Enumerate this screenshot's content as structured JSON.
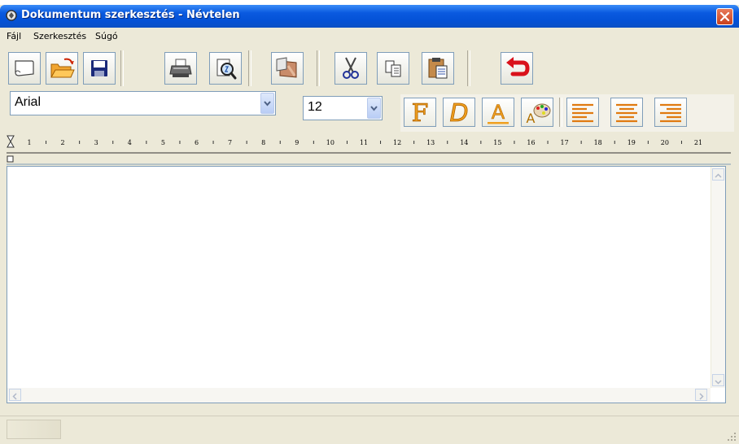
{
  "window": {
    "title": "Dokumentum szerkesztés - Névtelen"
  },
  "menubar": {
    "items": [
      {
        "label": "Fájl"
      },
      {
        "label": "Szerkesztés"
      },
      {
        "label": "Súgó"
      }
    ]
  },
  "toolbar": {
    "icons": [
      "new-document-icon",
      "open-folder-icon",
      "save-disk-icon",
      "print-icon",
      "print-preview-icon",
      "image-icon",
      "cut-scissors-icon",
      "copy-icon",
      "paste-icon",
      "undo-arrow-icon"
    ]
  },
  "format": {
    "font_name": "Arial",
    "font_size": "12",
    "bold_label": "F",
    "italic_label": "D",
    "underline_label": "A",
    "icons": [
      "bold-icon",
      "italic-icon",
      "underline-icon",
      "text-color-palette-icon",
      "align-left-icon",
      "align-center-icon",
      "align-right-icon"
    ]
  },
  "ruler": {
    "numbers": [
      "1",
      "2",
      "3",
      "4",
      "5",
      "6",
      "7",
      "8",
      "9",
      "10",
      "11",
      "12",
      "13",
      "14",
      "15",
      "16",
      "17",
      "18",
      "19",
      "20",
      "21"
    ]
  },
  "document": {
    "content": ""
  },
  "colors": {
    "title_blue": "#0a5ae0",
    "window_bg": "#ece9d8",
    "accent_orange": "#e08a1e"
  }
}
